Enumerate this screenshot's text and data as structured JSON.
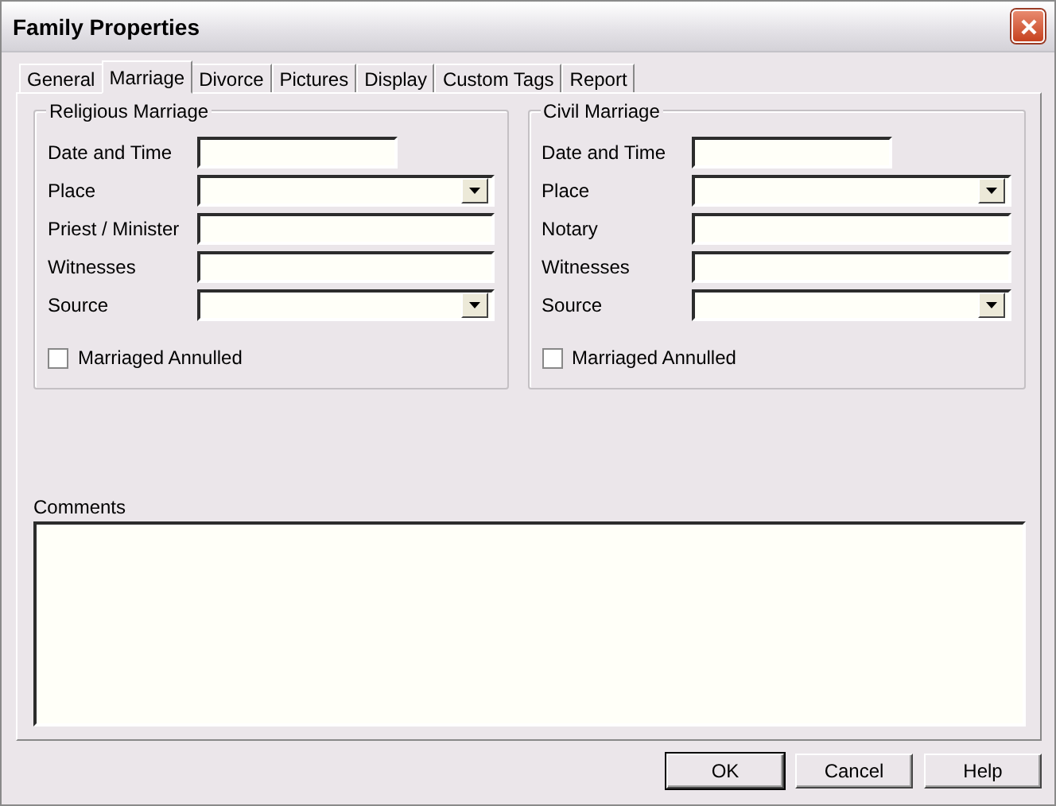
{
  "window": {
    "title": "Family Properties"
  },
  "tabs": [
    {
      "label": "General",
      "selected": false
    },
    {
      "label": "Marriage",
      "selected": true
    },
    {
      "label": "Divorce",
      "selected": false
    },
    {
      "label": "Pictures",
      "selected": false
    },
    {
      "label": "Display",
      "selected": false
    },
    {
      "label": "Custom Tags",
      "selected": false
    },
    {
      "label": "Report",
      "selected": false
    }
  ],
  "groups": [
    {
      "title": "Religious Marriage",
      "fields": [
        {
          "label": "Date and Time",
          "kind": "date"
        },
        {
          "label": "Place",
          "kind": "dropdown"
        },
        {
          "label": "Priest / Minister",
          "kind": "text"
        },
        {
          "label": "Witnesses",
          "kind": "text"
        },
        {
          "label": "Source",
          "kind": "dropdown"
        }
      ],
      "checkbox": {
        "label": "Marriaged Annulled",
        "checked": false
      }
    },
    {
      "title": "Civil Marriage",
      "fields": [
        {
          "label": "Date and Time",
          "kind": "date"
        },
        {
          "label": "Place",
          "kind": "dropdown"
        },
        {
          "label": "Notary",
          "kind": "text"
        },
        {
          "label": "Witnesses",
          "kind": "text"
        },
        {
          "label": "Source",
          "kind": "dropdown"
        }
      ],
      "checkbox": {
        "label": "Marriaged Annulled",
        "checked": false
      }
    }
  ],
  "comments": {
    "label": "Comments"
  },
  "buttons": [
    {
      "label": "OK",
      "default": true
    },
    {
      "label": "Cancel",
      "default": false
    },
    {
      "label": "Help",
      "default": false
    }
  ]
}
